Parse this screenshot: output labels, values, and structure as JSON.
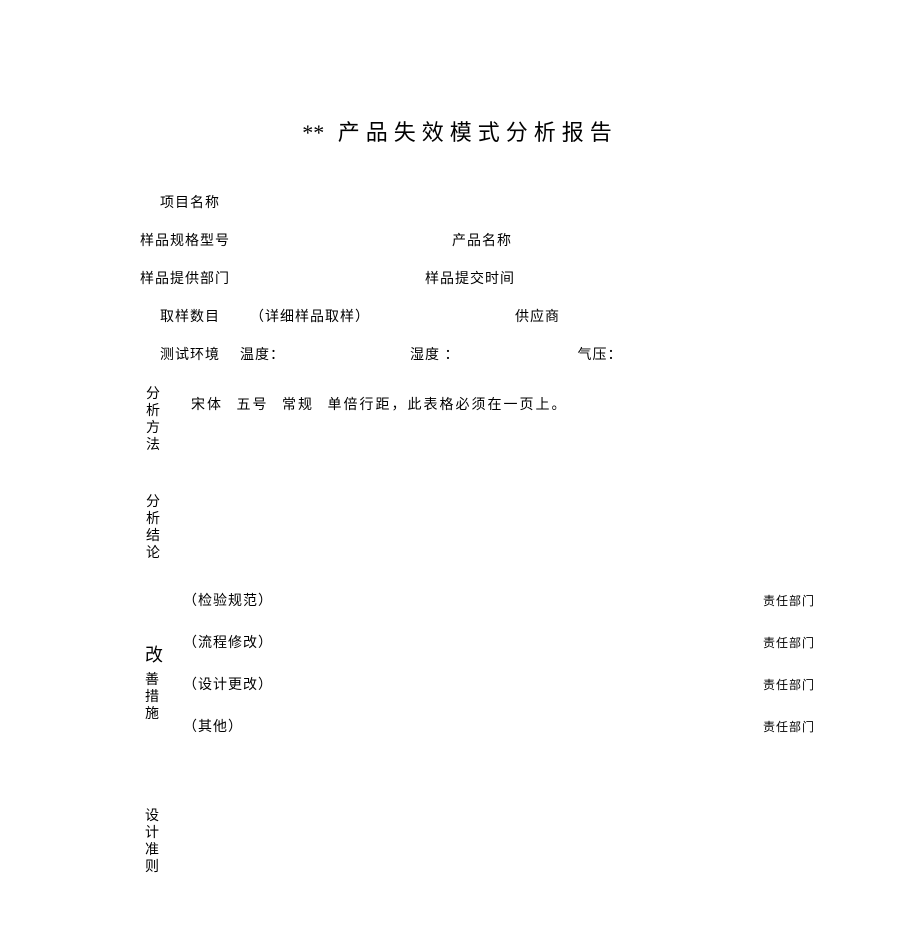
{
  "title": {
    "prefix": "**",
    "text": "产品失效模式分析报告"
  },
  "fields": {
    "project_name": "项目名称",
    "spec_model": "样品规格型号",
    "product_name": "产品名称",
    "provide_dept": "样品提供部门",
    "submit_time": "样品提交时间",
    "sample_count": "取样数目",
    "sample_detail": "（详细样品取样）",
    "supplier": "供应商",
    "test_env": "测试环境",
    "temperature": "温度：",
    "humidity": "湿度 ：",
    "pressure": "气压："
  },
  "sections": {
    "analysis_method": "分析方法",
    "analysis_conclusion": "分析结论",
    "improvement": "改善措施",
    "design_rule": "设计准则"
  },
  "method_content": {
    "font": "宋体",
    "size": "五号",
    "style": "常规",
    "spacing": "单倍行距，此表格必须在一页上。"
  },
  "improvements": [
    {
      "item": "（检验规范）",
      "resp": "责任部门"
    },
    {
      "item": "（流程修改）",
      "resp": "责任部门"
    },
    {
      "item": "（设计更改）",
      "resp": "责任部门"
    },
    {
      "item": "（其他）",
      "resp": "责任部门"
    }
  ]
}
